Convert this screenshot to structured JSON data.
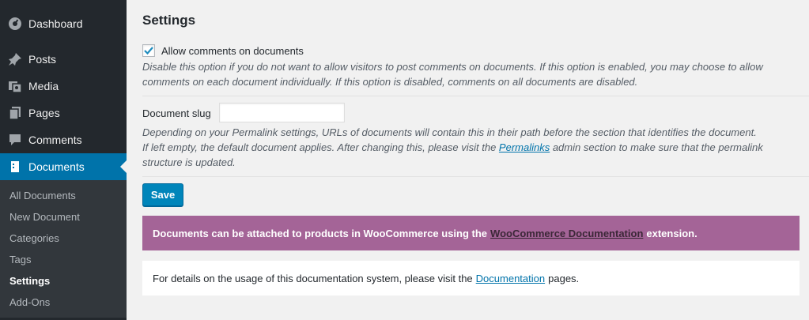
{
  "colors": {
    "sidebar_bg": "#23282d",
    "accent": "#0073aa",
    "woo_purple": "#a46497"
  },
  "sidebar": {
    "items": [
      {
        "label": "Dashboard",
        "icon": "dashboard-icon"
      },
      {
        "label": "Posts",
        "icon": "pin-icon"
      },
      {
        "label": "Media",
        "icon": "media-icon"
      },
      {
        "label": "Pages",
        "icon": "pages-icon"
      },
      {
        "label": "Comments",
        "icon": "comment-icon"
      },
      {
        "label": "Documents",
        "icon": "document-icon",
        "current": true
      }
    ],
    "submenu": [
      {
        "label": "All Documents"
      },
      {
        "label": "New Document"
      },
      {
        "label": "Categories"
      },
      {
        "label": "Tags"
      },
      {
        "label": "Settings",
        "active": true
      },
      {
        "label": "Add-Ons"
      }
    ]
  },
  "main": {
    "title": "Settings",
    "allow_comments": {
      "label": "Allow comments on documents",
      "checked": true,
      "desc_line1": "Disable this option if you do not want to allow visitors to post comments on documents. If this option is enabled, you may choose to allow",
      "desc_line2": "comments on each document individually. If this option is disabled, comments on all documents are disabled."
    },
    "slug": {
      "label": "Document slug",
      "value": "",
      "desc_line1": "Depending on your Permalink settings, URLs of documents will contain this in their path before the section that identifies the document.",
      "desc_line2_pre": "If left empty, the default document applies. After changing this, please visit the ",
      "desc_line2_link": "Permalinks",
      "desc_line2_post": " admin section to make sure that the permalink",
      "desc_line3": "structure is updated."
    },
    "save_label": "Save",
    "woo_notice": {
      "pre": "Documents can be attached to products in WooCommerce using the",
      "link": "WooCommerce Documentation",
      "post": "extension."
    },
    "help_notice": {
      "pre": "For details on the usage of this documentation system, please visit the",
      "link": "Documentation",
      "post": "pages."
    }
  }
}
